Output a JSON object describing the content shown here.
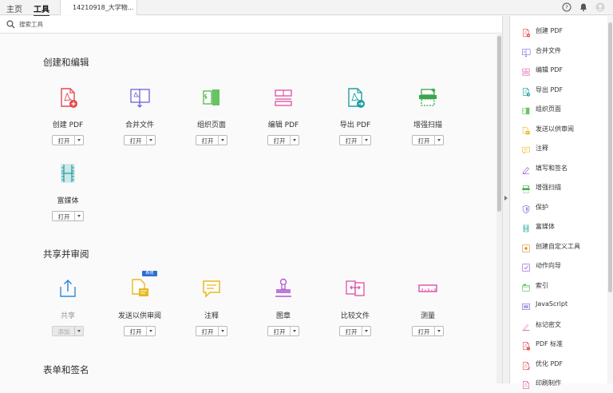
{
  "top_nav": {
    "home": "主页",
    "tools": "工具",
    "doc_tab": "14210918_大学物..."
  },
  "search": {
    "placeholder": "搜索工具"
  },
  "sections": {
    "create": "创建和编辑",
    "share": "共享并审阅",
    "forms": "表单和签名"
  },
  "create_tools": [
    {
      "label": "创建 PDF",
      "button": "打开",
      "icon": "create-pdf-icon",
      "color": "#e34850"
    },
    {
      "label": "合并文件",
      "button": "打开",
      "icon": "combine-files-icon",
      "color": "#6b62d8"
    },
    {
      "label": "组织页面",
      "button": "打开",
      "icon": "organize-pages-icon",
      "color": "#4cb848"
    },
    {
      "label": "编辑 PDF",
      "button": "打开",
      "icon": "edit-pdf-icon",
      "color": "#e04ea0"
    },
    {
      "label": "导出 PDF",
      "button": "打开",
      "icon": "export-pdf-icon",
      "color": "#1c9ea0"
    },
    {
      "label": "增强扫描",
      "button": "打开",
      "icon": "enhance-scan-icon",
      "color": "#3aa64a"
    },
    {
      "label": "富媒体",
      "button": "打开",
      "icon": "rich-media-icon",
      "color": "#1c9ea0"
    }
  ],
  "share_tools": [
    {
      "label": "共享",
      "button": "添加",
      "icon": "share-icon",
      "color": "#2d8ce0",
      "disabled": true
    },
    {
      "label": "发送以供审阅",
      "button": "打开",
      "icon": "send-for-review-icon",
      "color": "#e8b820",
      "badge": "新增"
    },
    {
      "label": "注释",
      "button": "打开",
      "icon": "comment-icon",
      "color": "#e8b820"
    },
    {
      "label": "图章",
      "button": "打开",
      "icon": "stamp-icon",
      "color": "#b05ad0"
    },
    {
      "label": "比较文件",
      "button": "打开",
      "icon": "compare-files-icon",
      "color": "#e04ea0"
    },
    {
      "label": "测量",
      "button": "打开",
      "icon": "measure-icon",
      "color": "#e04ea0"
    }
  ],
  "right_panel": [
    {
      "label": "创建 PDF",
      "icon": "create-pdf-icon",
      "color": "#e34850"
    },
    {
      "label": "合并文件",
      "icon": "combine-files-icon",
      "color": "#6b62d8"
    },
    {
      "label": "编辑 PDF",
      "icon": "edit-pdf-icon",
      "color": "#e04ea0"
    },
    {
      "label": "导出 PDF",
      "icon": "export-pdf-icon",
      "color": "#1c9ea0"
    },
    {
      "label": "组织页面",
      "icon": "organize-pages-icon",
      "color": "#4cb848"
    },
    {
      "label": "发送以供审阅",
      "icon": "send-for-review-icon",
      "color": "#e8b820"
    },
    {
      "label": "注释",
      "icon": "comment-icon",
      "color": "#e8b820"
    },
    {
      "label": "填写和签名",
      "icon": "fill-sign-icon",
      "color": "#9050d0"
    },
    {
      "label": "增强扫描",
      "icon": "enhance-scan-icon",
      "color": "#3aa64a"
    },
    {
      "label": "保护",
      "icon": "protect-icon",
      "color": "#6b62d8"
    },
    {
      "label": "富媒体",
      "icon": "rich-media-icon",
      "color": "#1c9ea0"
    },
    {
      "label": "创建自定义工具",
      "icon": "custom-tool-icon",
      "color": "#e88a20"
    },
    {
      "label": "动作向导",
      "icon": "action-wizard-icon",
      "color": "#9050d0"
    },
    {
      "label": "索引",
      "icon": "index-icon",
      "color": "#4cb848"
    },
    {
      "label": "JavaScript",
      "icon": "javascript-icon",
      "color": "#6b62d8"
    },
    {
      "label": "标记密文",
      "icon": "redact-icon",
      "color": "#e04ea0"
    },
    {
      "label": "PDF 标准",
      "icon": "pdf-standards-icon",
      "color": "#e34850"
    },
    {
      "label": "优化 PDF",
      "icon": "optimize-pdf-icon",
      "color": "#e34850"
    },
    {
      "label": "印刷制作",
      "icon": "print-production-icon",
      "color": "#e04ea0"
    }
  ]
}
